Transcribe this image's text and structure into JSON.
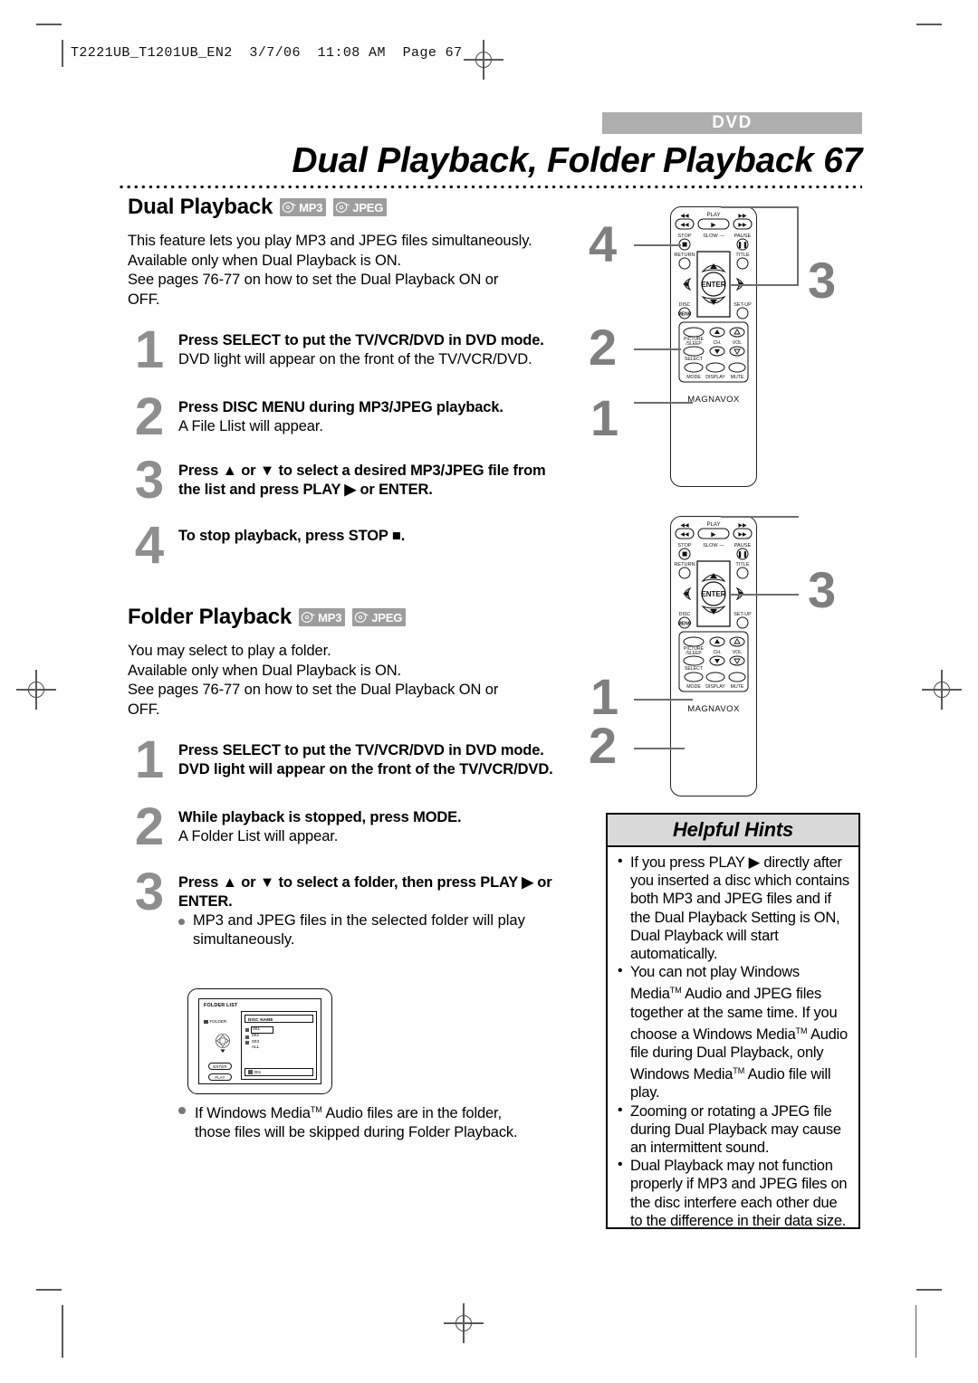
{
  "file_header": "T2221UB_T1201UB_EN2  3/7/06  11:08 AM  Page 67",
  "header": {
    "category_tab": "DVD",
    "title": "Dual Playback, Folder Playback  67"
  },
  "sections": [
    {
      "heading": "Dual Playback",
      "badges": [
        "MP3",
        "JPEG"
      ],
      "intro": [
        "This feature lets you play MP3 and JPEG files simultaneously.",
        "Available only when Dual Playback is ON.",
        "See pages 76-77 on how to set the Dual Playback ON or",
        "OFF."
      ],
      "steps": [
        {
          "num": "1",
          "head": "Press SELECT to put the TV/VCR/DVD in DVD mode.",
          "sub": "DVD light will appear on the front of the TV/VCR/DVD.",
          "sub_bold": false
        },
        {
          "num": "2",
          "head": "Press DISC MENU during MP3/JPEG playback.",
          "sub": "A File Llist will appear.",
          "sub_bold": false
        },
        {
          "num": "3",
          "head": "Press ▲ or ▼ to select a desired MP3/JPEG file from the list and press PLAY ▶ or ENTER.",
          "sub": "",
          "sub_bold": false
        },
        {
          "num": "4",
          "head": "To stop playback, press STOP ■.",
          "sub": "",
          "sub_bold": false
        }
      ]
    },
    {
      "heading": "Folder Playback",
      "badges": [
        "MP3",
        "JPEG"
      ],
      "intro": [
        "You may select to play a folder.",
        "Available only when Dual Playback is ON.",
        "See pages 76-77 on how to set the Dual Playback ON or",
        "OFF."
      ],
      "steps": [
        {
          "num": "1",
          "head": "Press SELECT to put the TV/VCR/DVD in DVD mode.",
          "sub": "DVD light will appear on the front of the TV/VCR/DVD.",
          "sub_bold": true
        },
        {
          "num": "2",
          "head": "While playback is stopped, press MODE.",
          "sub": "A Folder List will appear.",
          "sub_bold": false
        },
        {
          "num": "3",
          "head": "Press ▲ or ▼ to select a folder, then press PLAY ▶ or ENTER.",
          "bullet": "MP3 and JPEG files in the selected folder will play simultaneously.",
          "sub": "",
          "sub_bold": false
        }
      ]
    }
  ],
  "osd": {
    "title": "FOLDER LIST",
    "folder_tag": "FOLDER",
    "disc_name": "DISC NAME",
    "items": [
      "001",
      "002",
      "003",
      "ALL"
    ],
    "selected": "001",
    "status": "001",
    "keys": [
      "ENTER",
      "PLAY"
    ]
  },
  "footnote": "If Windows Media™ Audio files are in the folder, those files will be skipped during Folder Playback.",
  "remotes": [
    {
      "brand": "MAGNAVOX",
      "callouts": [
        "4",
        "3",
        "2",
        "1"
      ],
      "keys": {
        "play": "PLAY",
        "stop": "STOP",
        "slow": "SLOW",
        "pause": "PAUSE",
        "return": "RETURN",
        "title": "TITLE",
        "enter": "ENTER",
        "disc": "DISC",
        "disc_btn": "MENU",
        "setup": "SET-UP",
        "picture_sleep": "PICTURE\n/SLEEP",
        "ch": "CH.",
        "vol": "VOL",
        "select": "SELECT",
        "mode": "MODE",
        "display": "DISPLAY",
        "mute": "MUTE"
      }
    },
    {
      "brand": "MAGNAVOX",
      "callouts": [
        "3",
        "1",
        "2"
      ],
      "keys": {
        "play": "PLAY",
        "stop": "STOP",
        "slow": "SLOW",
        "pause": "PAUSE",
        "return": "RETURN",
        "title": "TITLE",
        "enter": "ENTER",
        "disc": "DISC",
        "disc_btn": "MENU",
        "setup": "SET-UP",
        "picture_sleep": "PICTURE\n/SLEEP",
        "ch": "CH.",
        "vol": "VOL",
        "select": "SELECT",
        "mode": "MODE",
        "display": "DISPLAY",
        "mute": "MUTE"
      }
    }
  ],
  "hints": {
    "title": "Helpful Hints",
    "items": [
      "If you press PLAY ▶ directly after you inserted a disc which contains both MP3 and JPEG files and if the Dual Playback Setting is ON, Dual Playback will start automatically.",
      "You can not play Windows Media™ Audio and JPEG files together at the same time.  If you choose a Windows Media™ Audio file during Dual Playback, only Windows Media™ Audio file will play.",
      "Zooming or rotating a JPEG file during Dual Playback may cause an intermittent sound.",
      "Dual Playback may not function properly if MP3 and JPEG files on the disc interfere each other due to the difference in their data size."
    ]
  }
}
